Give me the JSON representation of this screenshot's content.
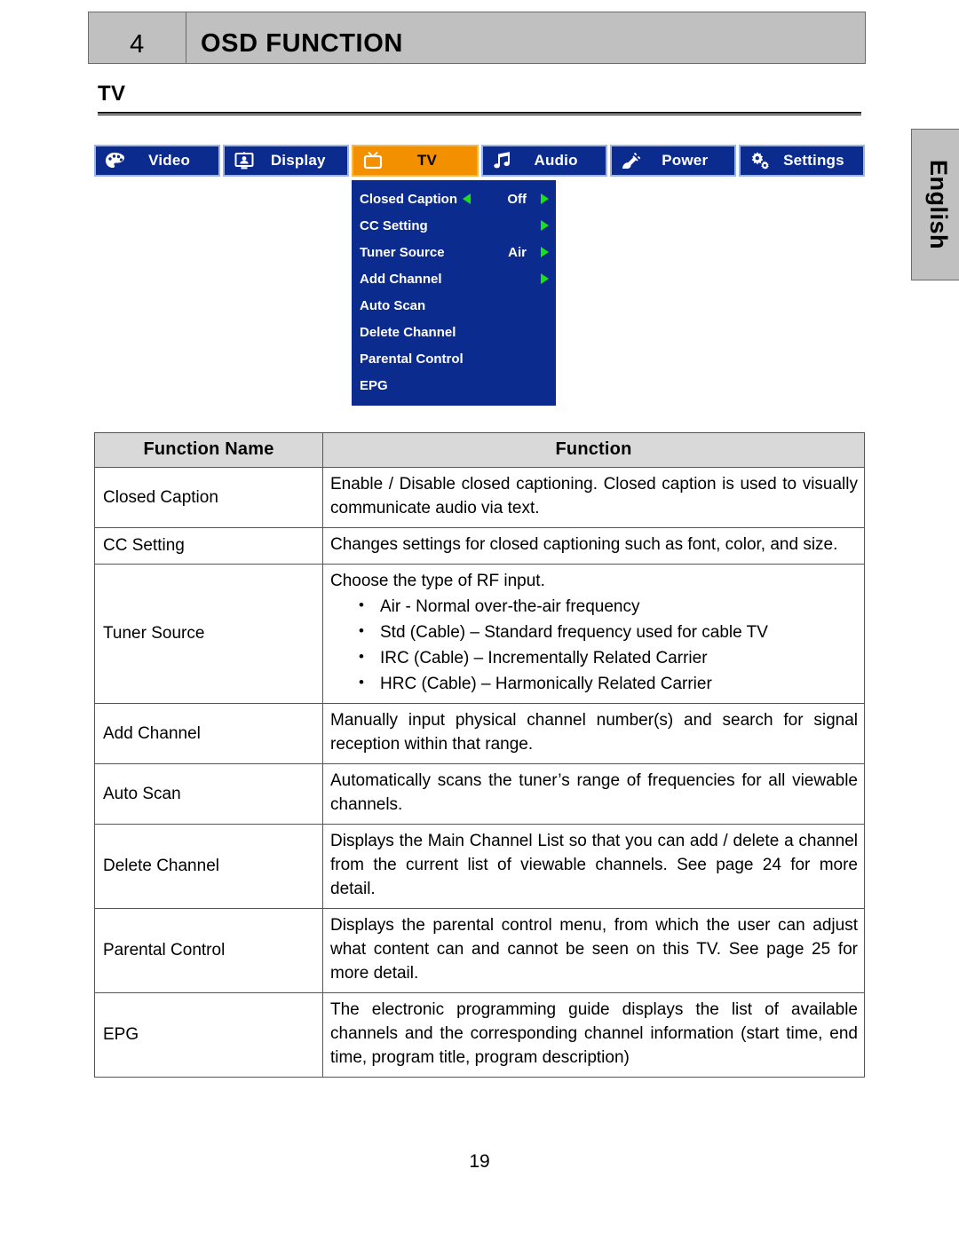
{
  "header": {
    "chapter_number": "4",
    "chapter_title": "OSD FUNCTION"
  },
  "section": {
    "heading": "TV"
  },
  "language_tab": {
    "label": "English"
  },
  "osd_menu_bar": {
    "tabs": [
      {
        "label": "Video",
        "icon": "palette-icon",
        "active": false
      },
      {
        "label": "Display",
        "icon": "monitor-icon",
        "active": false
      },
      {
        "label": "TV",
        "icon": "tv-icon",
        "active": true
      },
      {
        "label": "Audio",
        "icon": "music-note-icon",
        "active": false
      },
      {
        "label": "Power",
        "icon": "power-plug-icon",
        "active": false
      },
      {
        "label": "Settings",
        "icon": "gears-icon",
        "active": false
      }
    ],
    "active_tab": "TV",
    "colors": {
      "tab_blue": "#0b2b8e",
      "tab_active_orange": "#f39000",
      "tab_border": "#9fb4e8",
      "arrow_green": "#1ae01a"
    }
  },
  "osd_dropdown": {
    "items": [
      {
        "label": "Closed Caption",
        "value": "Off",
        "left_arrow": true,
        "right_arrow": true
      },
      {
        "label": "CC Setting",
        "value": "",
        "left_arrow": false,
        "right_arrow": true
      },
      {
        "label": "Tuner Source",
        "value": "Air",
        "left_arrow": false,
        "right_arrow": true
      },
      {
        "label": "Add Channel",
        "value": "",
        "left_arrow": false,
        "right_arrow": true
      },
      {
        "label": "Auto Scan",
        "value": "",
        "left_arrow": false,
        "right_arrow": false
      },
      {
        "label": "Delete Channel",
        "value": "",
        "left_arrow": false,
        "right_arrow": false
      },
      {
        "label": "Parental Control",
        "value": "",
        "left_arrow": false,
        "right_arrow": false
      },
      {
        "label": "EPG",
        "value": "",
        "left_arrow": false,
        "right_arrow": false
      }
    ]
  },
  "function_table": {
    "headers": {
      "name": "Function Name",
      "function": "Function"
    },
    "rows": [
      {
        "name": "Closed Caption",
        "desc": "Enable / Disable closed captioning. Closed caption is used to visually communicate audio via text."
      },
      {
        "name": "CC Setting",
        "desc": "Changes settings for closed captioning such as font, color, and size."
      },
      {
        "name": "Tuner Source",
        "desc": "Choose the type of RF input.",
        "bullets": [
          "Air - Normal over-the-air frequency",
          "Std (Cable) – Standard frequency used for cable TV",
          "IRC (Cable) – Incrementally Related Carrier",
          "HRC (Cable) – Harmonically Related Carrier"
        ]
      },
      {
        "name": "Add Channel",
        "desc": "Manually input physical channel number(s) and search for signal reception within that range."
      },
      {
        "name": "Auto Scan",
        "desc": "Automatically scans the tuner’s range of frequencies for all viewable channels."
      },
      {
        "name": "Delete Channel",
        "desc": "Displays the Main Channel List so that you can add / delete a channel from the current list of viewable channels. See page 24 for more detail."
      },
      {
        "name": "Parental Control",
        "desc": "Displays the parental control menu, from which the user can adjust what content can and cannot be seen on this TV. See page 25 for more detail."
      },
      {
        "name": "EPG",
        "desc": "The electronic programming guide displays the list of available channels and the corresponding channel information (start time, end time, program title, program description)"
      }
    ]
  },
  "footer": {
    "page_number": "19"
  }
}
